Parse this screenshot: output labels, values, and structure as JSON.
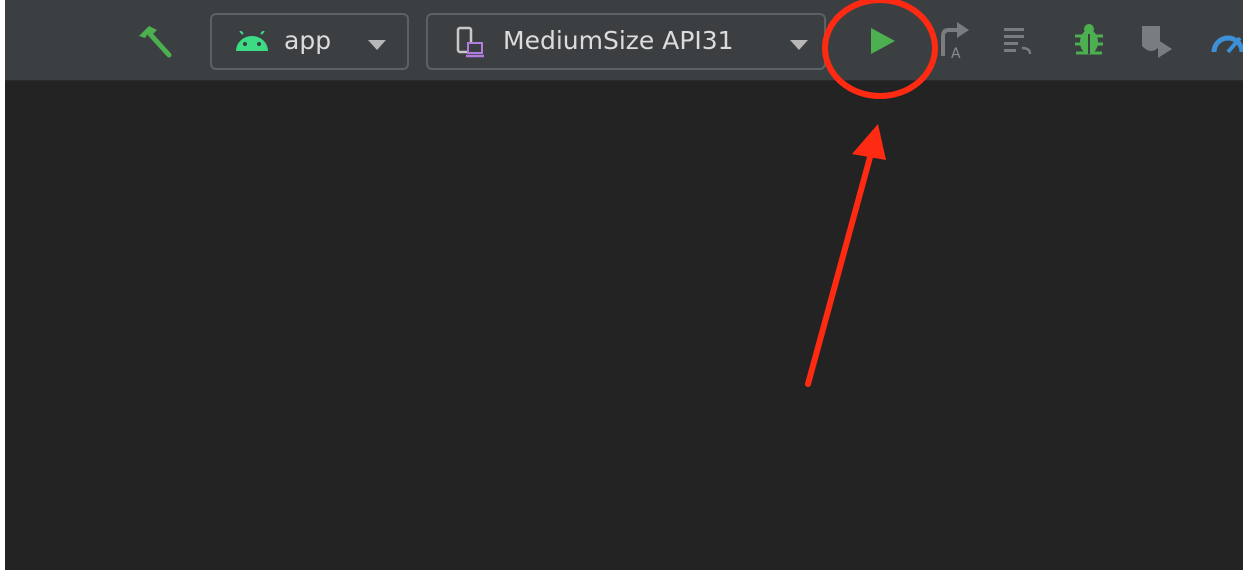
{
  "toolbar": {
    "module_selector": {
      "label": "app",
      "icon": "android-icon"
    },
    "device_selector": {
      "label": "MediumSize API31",
      "icon": "device-icon"
    },
    "icons": [
      "hammer-icon",
      "run-icon",
      "apply-changes-icon",
      "apply-code-changes-icon",
      "debug-icon",
      "attach-debugger-icon",
      "profiler-icon"
    ]
  },
  "colors": {
    "toolbar_bg": "#3c3f41",
    "editor_bg": "#232323",
    "accent_green": "#4caf50",
    "android_green": "#3ddc84",
    "annotation_red": "#ff2a12"
  }
}
